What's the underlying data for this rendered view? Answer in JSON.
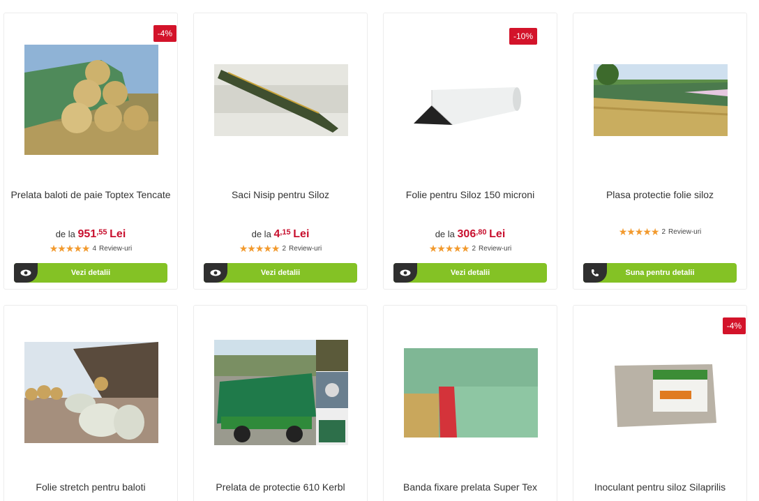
{
  "products": [
    {
      "name": "Prelata baloti de paie Toptex Tencate",
      "badge": "-4%",
      "price_prefix": "de la",
      "price_int": "951",
      "price_dec": ",55",
      "currency": "Lei",
      "rating_count": "4",
      "rating_label": "Review-uri",
      "rating": 5,
      "button": "Vezi detalii",
      "button_icon": "eye-icon"
    },
    {
      "name": "Saci Nisip pentru Siloz",
      "badge": "",
      "price_prefix": "de la",
      "price_int": "4",
      "price_dec": ",15",
      "currency": "Lei",
      "rating_count": "2",
      "rating_label": "Review-uri",
      "rating": 5,
      "button": "Vezi detalii",
      "button_icon": "eye-icon"
    },
    {
      "name": "Folie pentru Siloz 150 microni",
      "badge": "-10%",
      "price_prefix": "de la",
      "price_int": "306",
      "price_dec": ",80",
      "currency": "Lei",
      "rating_count": "2",
      "rating_label": "Review-uri",
      "rating": 5,
      "button": "Vezi detalii",
      "button_icon": "eye-icon"
    },
    {
      "name": "Plasa protectie folie siloz",
      "badge": "",
      "rating_count": "2",
      "rating_label": "Review-uri",
      "rating": 5,
      "button": "Suna pentru detalii",
      "button_icon": "phone-icon"
    },
    {
      "name": "Folie stretch pentru baloti",
      "badge": ""
    },
    {
      "name": "Prelata de protectie 610 Kerbl",
      "badge": ""
    },
    {
      "name": "Banda fixare prelata Super Tex",
      "badge": ""
    },
    {
      "name": "Inoculant pentru siloz Silaprilis",
      "badge": "-4%"
    }
  ],
  "stars": "★★★★★",
  "colors": {
    "accent": "#84c225",
    "price": "#c8102e",
    "badge": "#d3132a",
    "stars": "#f29a2e"
  }
}
